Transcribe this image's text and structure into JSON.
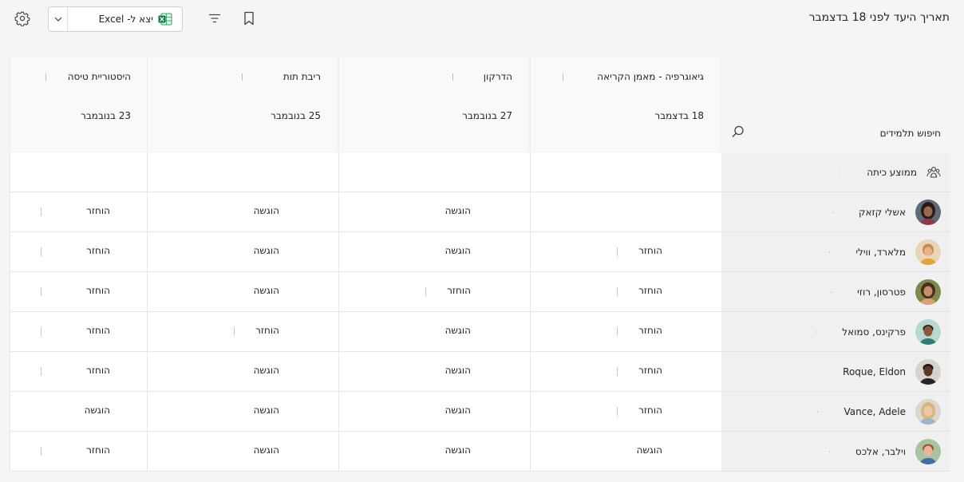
{
  "header": {
    "title": "תאריך היעד לפני 18 בדצמבר",
    "export_label": "יצא ל- Excel"
  },
  "icons": {
    "settings": "gear-icon",
    "export_chevron": "chevron-down-icon",
    "excel": "excel-icon",
    "filter": "filter-icon",
    "bookmark": "bookmark-icon",
    "search": "search-icon",
    "class_average": "class-average-icon"
  },
  "colors": {
    "excel_green": "#107c41",
    "accent": "#242424"
  },
  "search": {
    "label": "חיפוש תלמידים"
  },
  "assignments": [
    {
      "title": "גיאוגרפיה - מאמן הקריאה",
      "due": "18 בדצמבר"
    },
    {
      "title": "הדרקון",
      "due": "27 בנובמבר"
    },
    {
      "title": "ריבת תות",
      "due": "25 בנובמבר"
    },
    {
      "title": "היסטוריית טיסה",
      "due": "23 בנובמבר"
    }
  ],
  "class_average": {
    "label": "ממוצע כיתה"
  },
  "students": [
    {
      "name": "אשלי קזאק",
      "statuses": [
        "",
        "הוגשה",
        "הוגשה",
        "הוחזר"
      ]
    },
    {
      "name": "מלארד, ווילי",
      "statuses": [
        "הוחזר",
        "הוגשה",
        "הוגשה",
        "הוחזר"
      ]
    },
    {
      "name": "פטרסון, רוזי",
      "statuses": [
        "הוחזר",
        "הוחזר",
        "הוגשה",
        "הוחזר"
      ]
    },
    {
      "name": "פרקינס, סמואל",
      "statuses": [
        "הוחזר",
        "הוגשה",
        "הוחזר",
        "הוחזר"
      ]
    },
    {
      "name": "Roque, Eldon",
      "statuses": [
        "הוחזר",
        "הוגשה",
        "הוגשה",
        "הוחזר"
      ]
    },
    {
      "name": "Vance, Adele",
      "statuses": [
        "הוחזר",
        "הוגשה",
        "הוגשה",
        "הוגשה"
      ]
    },
    {
      "name": "וילבר, אלכס",
      "statuses": [
        "הוגשה",
        "הוגשה",
        "הוגשה",
        "הוחזר"
      ]
    }
  ]
}
